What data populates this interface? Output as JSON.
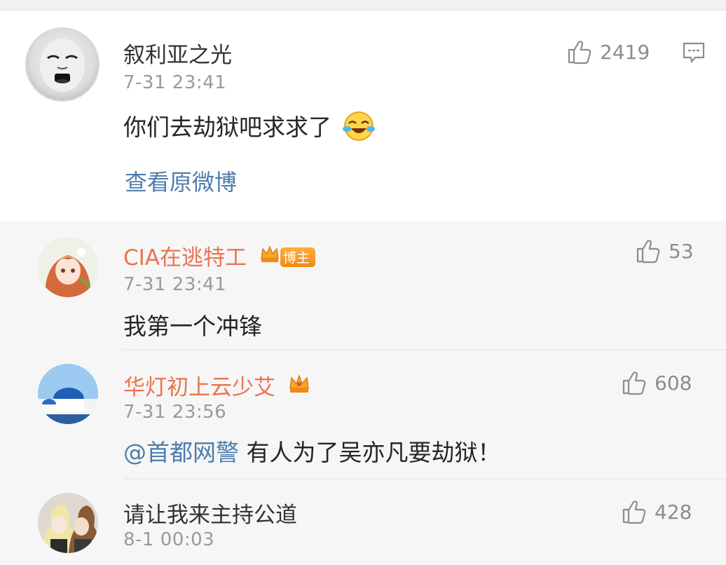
{
  "main_comment": {
    "author": "叙利亚之光",
    "time": "7-31 23:41",
    "text": "你们去劫狱吧求求了",
    "likes": "2419",
    "view_original": "查看原微博",
    "avatar_icon": "meme-face-avatar",
    "emoji_icon": "laugh-cry-emoji"
  },
  "replies": [
    {
      "author": "CIA在逃特工",
      "badge": "博主",
      "time": "7-31 23:41",
      "text": "我第一个冲锋",
      "likes": "53",
      "avatar_icon": "anime-girl-avatar"
    },
    {
      "author": "华灯初上云少艾",
      "time": "7-31 23:56",
      "mention": "@首都网警",
      "text": " 有人为了吴亦凡要劫狱！",
      "likes": "608",
      "avatar_icon": "santorini-avatar"
    },
    {
      "author": "请让我来主持公道",
      "time": "8-1 00:03",
      "likes": "428",
      "avatar_icon": "couple-drawing-avatar"
    }
  ],
  "colors": {
    "vip_name": "#eb7350",
    "normal_name": "#333333",
    "link": "#4f7cad",
    "timestamp": "#9a9a9a"
  }
}
